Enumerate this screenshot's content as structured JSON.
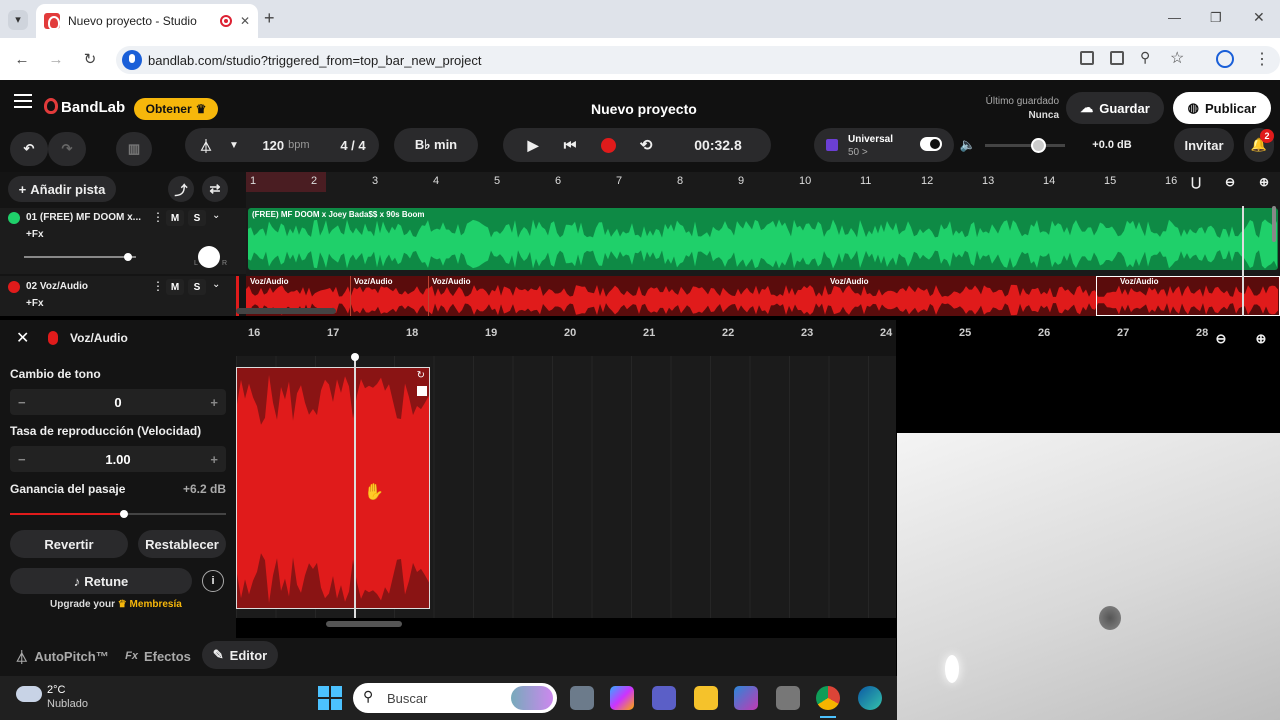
{
  "browser": {
    "tab_title": "Nuevo proyecto - Studio",
    "new_tab": "+",
    "url": "bandlab.com/studio?triggered_from=top_bar_new_project",
    "win_min": "—",
    "win_max": "❐",
    "win_close": "✕"
  },
  "header": {
    "logo": "BandLab",
    "get_button": "Obtener",
    "project_title": "Nuevo proyecto",
    "last_saved_label": "Último guardado",
    "last_saved_value": "Nunca",
    "save_button": "Guardar",
    "publish_button": "Publicar"
  },
  "transport": {
    "bpm": "120",
    "bpm_unit": "bpm",
    "time_signature": "4 / 4",
    "key": "B♭ min",
    "time": "00:32.8",
    "preset_name": "Universal",
    "preset_sub": "50 >",
    "volume_db": "+0.0 dB",
    "invite_button": "Invitar",
    "notification_count": "2"
  },
  "tracks": {
    "add_track": "Añadir pista",
    "items": [
      {
        "label": "01  (FREE) MF DOOM x...",
        "fx": "+Fx",
        "mute": "M",
        "solo": "S",
        "color": "#1fd06a"
      },
      {
        "label": "02  Voz/Audio",
        "fx": "+Fx",
        "mute": "M",
        "solo": "S",
        "color": "#e01b1b"
      }
    ],
    "pan_l": "L",
    "pan_r": "R"
  },
  "ruler_top": [
    "1",
    "2",
    "3",
    "4",
    "5",
    "6",
    "7",
    "8",
    "9",
    "10",
    "11",
    "12",
    "13",
    "14",
    "15",
    "16"
  ],
  "clips": {
    "track1_clip": "(FREE) MF DOOM x Joey Bada$$ x 90s Boom",
    "track2_clips": [
      "Voz/Audio",
      "Voz/Audio",
      "Voz/Audio",
      "Voz/Audio",
      "Voz/Audio"
    ]
  },
  "editor": {
    "title": "Voz/Audio",
    "pitch_label": "Cambio de tono",
    "pitch_value": "0",
    "rate_label": "Tasa de reproducción (Velocidad)",
    "rate_value": "1.00",
    "gain_label": "Ganancia del pasaje",
    "gain_value": "+6.2 dB",
    "gain_level_fraction": 0.53,
    "revert_button": "Revertir",
    "reset_button": "Restablecer",
    "retune_button": "Retune",
    "upgrade_prefix": "Upgrade your",
    "upgrade_link": "Membresía",
    "ruler": [
      "16",
      "17",
      "18",
      "19",
      "20",
      "21",
      "22",
      "23",
      "24",
      "25",
      "26",
      "27",
      "28"
    ],
    "minus": "−",
    "plus": "+"
  },
  "bottom_tabs": [
    "AutoPitch™",
    "Efectos",
    "Editor"
  ],
  "taskbar": {
    "weather_temp": "2°C",
    "weather_desc": "Nublado",
    "search_placeholder": "Buscar"
  },
  "colors": {
    "accent_red": "#e01b1b",
    "accent_green": "#1fd06a",
    "brand_yellow": "#f6b70b"
  }
}
